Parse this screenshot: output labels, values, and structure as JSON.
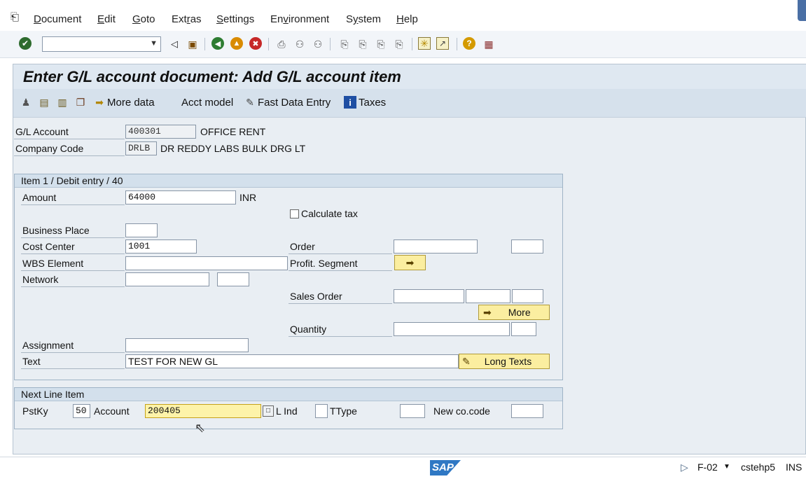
{
  "menu": {
    "items": [
      "Document",
      "Edit",
      "Goto",
      "Extras",
      "Settings",
      "Environment",
      "System",
      "Help"
    ],
    "underlines": [
      "D",
      "E",
      "G",
      "r",
      "S",
      "v",
      "y",
      "H"
    ]
  },
  "toolbar": {
    "command_value": ""
  },
  "title": "Enter G/L account document: Add G/L account item",
  "app_toolbar": {
    "more_data": "More data",
    "acct_model": "Acct model",
    "fast_entry": "Fast Data Entry",
    "taxes": "Taxes"
  },
  "header": {
    "gl_account_label": "G/L Account",
    "gl_account_value": "400301",
    "gl_account_desc": "OFFICE RENT",
    "company_code_label": "Company Code",
    "company_code_value": "DRLB",
    "company_code_desc": "DR REDDY LABS BULK DRG LT"
  },
  "item": {
    "group_title": "Item 1 / Debit entry / 40",
    "amount_label": "Amount",
    "amount_value": "64000",
    "currency": "INR",
    "calc_tax_label": "Calculate tax",
    "calc_tax_checked": false,
    "business_place_label": "Business Place",
    "business_place_value": "",
    "cost_center_label": "Cost Center",
    "cost_center_value": "1001",
    "wbs_label": "WBS Element",
    "wbs_value": "",
    "network_label": "Network",
    "network_value": "",
    "order_label": "Order",
    "order_value": "",
    "profit_segment_label": "Profit. Segment",
    "sales_order_label": "Sales Order",
    "more_button": "More",
    "quantity_label": "Quantity",
    "assignment_label": "Assignment",
    "assignment_value": "",
    "text_label": "Text",
    "text_value": "TEST FOR NEW GL",
    "long_texts_button": "Long Texts"
  },
  "next_line": {
    "group_title": "Next Line Item",
    "pstky_label": "PstKy",
    "pstky_value": "50",
    "account_label": "Account",
    "account_value": "200405",
    "sgl_ind_label": "L Ind",
    "ttype_label": "TType",
    "new_cocode_label": "New co.code"
  },
  "status": {
    "logo": "SAP",
    "transaction": "F-02",
    "server": "cstehp5",
    "mode": "INS"
  },
  "colors": {
    "title_bar": "#dfe8f1",
    "button_yellow": "#fbeea0",
    "sap_blue": "#2f78c4"
  }
}
